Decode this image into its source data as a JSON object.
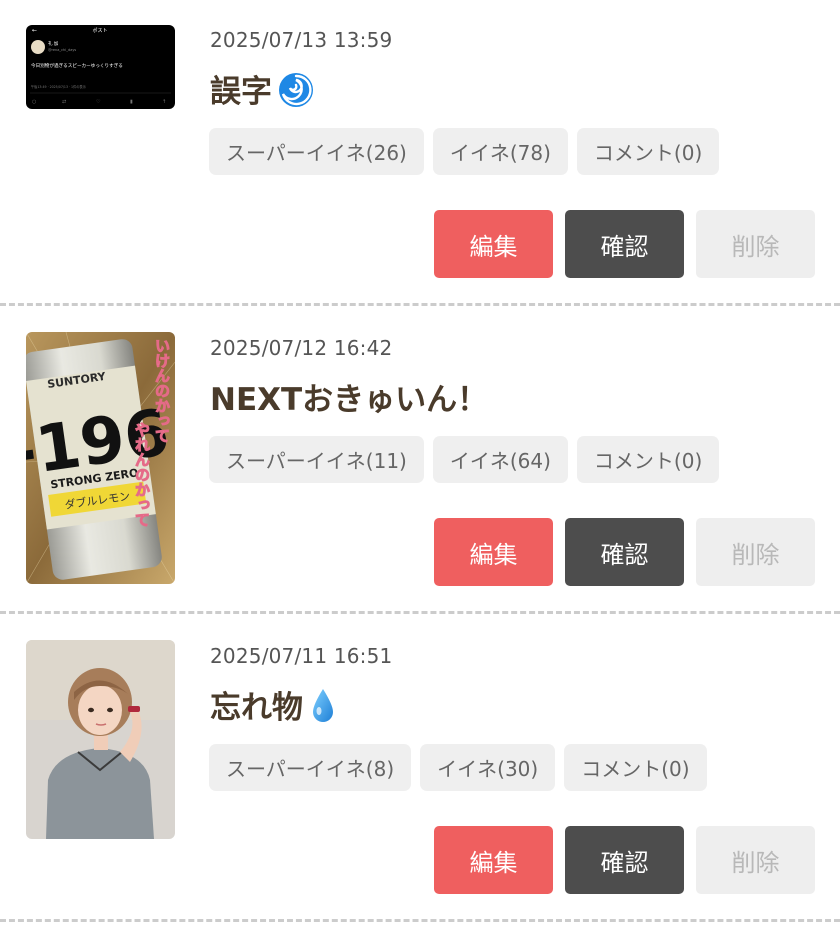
{
  "labels": {
    "super_iine": "スーパーイイネ",
    "iine": "イイネ",
    "comment": "コメント",
    "edit": "編集",
    "confirm": "確認",
    "delete": "削除"
  },
  "posts": [
    {
      "date": "2025/07/13 13:59",
      "title": "誤字",
      "emoji_icon": "cyclone-icon",
      "chips": [
        "スーパーイイネ(26)",
        "イイネ(78)",
        "コメント(0)"
      ],
      "thumbnail": {
        "kind": "tweet-screenshot",
        "header": "ポスト",
        "user": "礼 加",
        "handle": "@rena_chi_days",
        "text": "今日別物が過ぎるスピーカーゆっくりすぎる",
        "meta": "午後13:49 · 2025/07/13 · 1件の表示"
      }
    },
    {
      "date": "2025/07/12 16:42",
      "title": "NEXTおきゅいん！",
      "emoji_icon": "",
      "chips": [
        "スーパーイイネ(11)",
        "イイネ(64)",
        "コメント(0)"
      ],
      "thumbnail": {
        "kind": "can-photo",
        "brand": "SUNTORY",
        "number": "-196",
        "product": "STRONG ZERO",
        "flavor": "ダブルレモン",
        "overlay_1": "いけんのかって",
        "overlay_2": "やれんのかって"
      }
    },
    {
      "date": "2025/07/11 16:51",
      "title": "忘れ物",
      "emoji_icon": "droplet-icon",
      "chips": [
        "スーパーイイネ(8)",
        "イイネ(30)",
        "コメント(0)"
      ],
      "thumbnail": {
        "kind": "portrait-photo"
      }
    }
  ],
  "colors": {
    "edit": "#ef5f5f",
    "confirm": "#4d4d4d",
    "delete": "#eeeeee",
    "title": "#4a3b2b"
  }
}
